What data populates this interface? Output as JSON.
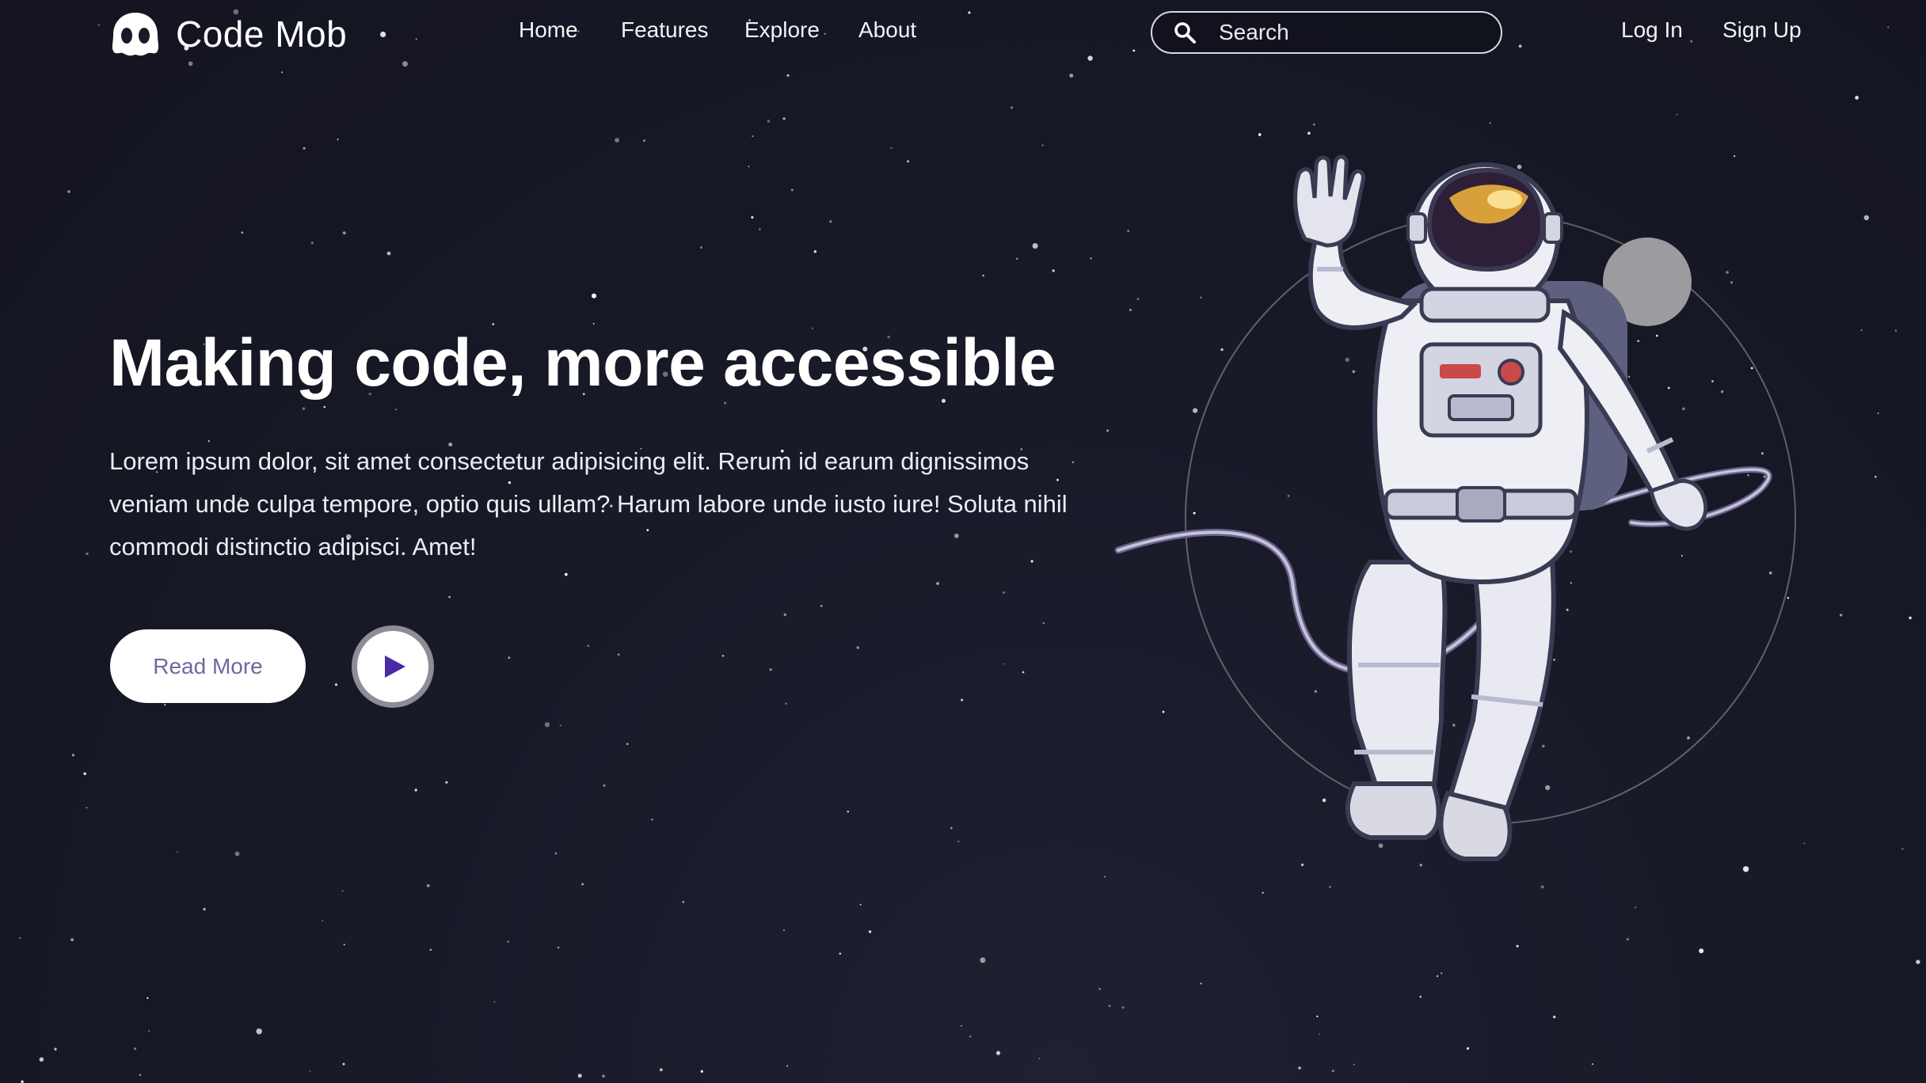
{
  "brand": {
    "name": "Code Mob",
    "icon": "ghost-logo-icon"
  },
  "nav": {
    "items": [
      {
        "label": "Home"
      },
      {
        "label": "Features"
      },
      {
        "label": "Explore"
      },
      {
        "label": "About"
      }
    ]
  },
  "search": {
    "placeholder": "Search",
    "value": "",
    "icon": "search-icon"
  },
  "auth": {
    "login_label": "Log In",
    "signup_label": "Sign Up"
  },
  "hero": {
    "title": "Making code, more accessible",
    "text": "Lorem ipsum dolor, sit amet consectetur adipisicing elit. Rerum id earum dignissimos veniam unde culpa tempore, optio quis ullam? Harum labore unde iusto iure! Soluta nihil commodi distinctio adipisci. Amet!",
    "read_more_label": "Read More",
    "play_icon": "play-icon"
  },
  "illustration": {
    "subject": "astronaut-icon"
  },
  "colors": {
    "background": "#181a28",
    "text": "#ffffff",
    "button_text": "#6b6a9e",
    "play_accent": "#4b2aa6",
    "play_ring": "#8d8d96"
  }
}
